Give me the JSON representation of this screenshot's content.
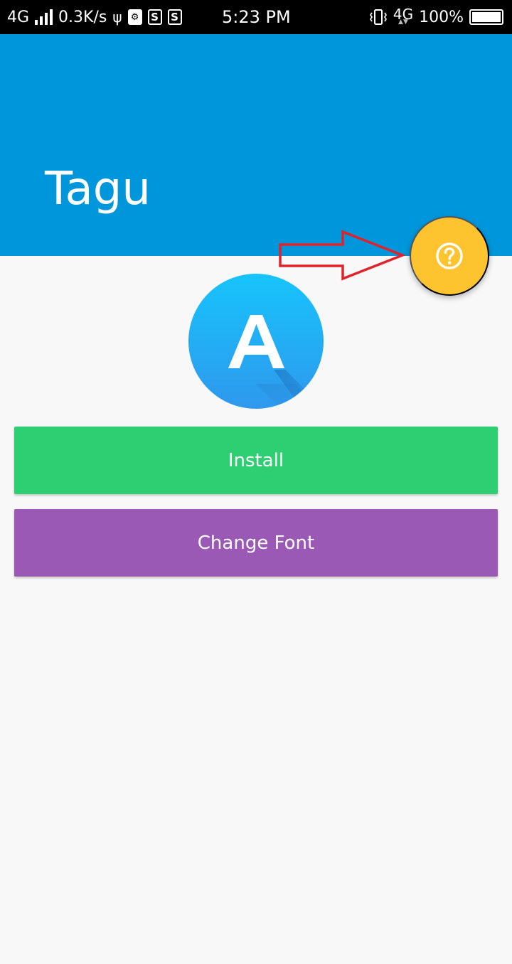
{
  "status_bar": {
    "network_left": "4G",
    "speed": "0.3K/s",
    "time": "5:23 PM",
    "network_right": "4G",
    "battery": "100%",
    "notification_glyph": "S",
    "icons": [
      "signal-icon",
      "usb-icon",
      "usb-debug-icon",
      "sim-s-icon",
      "sim-s-icon",
      "vibrate-icon",
      "battery-icon"
    ]
  },
  "app_bar": {
    "title": "Tagu",
    "color": "#0096db"
  },
  "fab": {
    "icon": "help-icon",
    "color": "#fdc430"
  },
  "logo": {
    "letter": "A",
    "icon": "app-logo-icon"
  },
  "buttons": {
    "install": {
      "label": "Install",
      "color": "#2ecf72"
    },
    "change_font": {
      "label": "Change Font",
      "color": "#9b59b6"
    }
  },
  "annotation": {
    "icon": "arrow-right-icon",
    "color": "#e0232a"
  }
}
